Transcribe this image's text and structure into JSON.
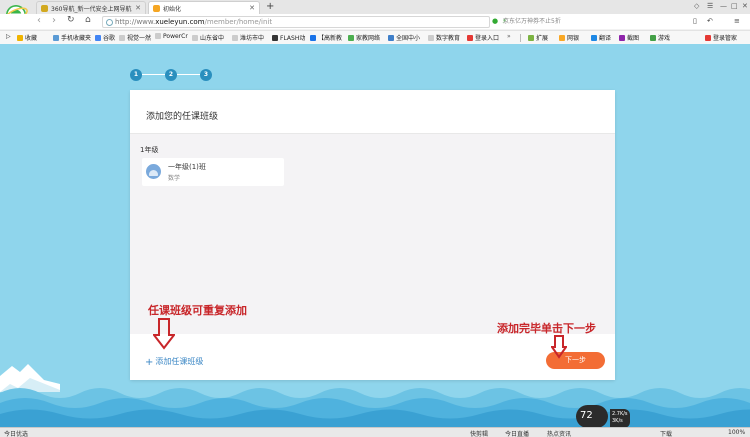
{
  "browser": {
    "tabs": [
      {
        "title": "360导航_新一代安全上网导航"
      },
      {
        "title": "初始化"
      }
    ],
    "new_tab": "+",
    "address": {
      "prefix": "http://www.",
      "domain": "xueleyun.com",
      "path": "/member/home/init"
    },
    "search_placeholder": "京东亿万神券不止5折",
    "bookmarks": [
      "收藏",
      "手机收藏夹",
      "谷歌",
      "视觉一然",
      "PowerCr",
      "山东省中",
      "潍坊市中",
      "FLASH动",
      "【高新教",
      "家教网络",
      "全国中小",
      "数字教育",
      "登录入口"
    ],
    "right_tools": [
      "扩展",
      "网银",
      "翻译",
      "截图",
      "游戏",
      "登录管家"
    ]
  },
  "wizard": {
    "steps": [
      "1",
      "2",
      "3"
    ],
    "title": "添加您的任课班级",
    "grade_label": "1年级",
    "class": {
      "name": "一年级(1)班",
      "subject": "数学"
    },
    "add_link": "添加任课班级",
    "next_button": "下一步"
  },
  "annotations": {
    "left": "任课班级可重复添加",
    "right": "添加完毕单击下一步"
  },
  "status_bar": {
    "left": "今日优选",
    "items": [
      "快剪辑",
      "今日直播",
      "热点资讯"
    ],
    "download": "下载",
    "zoom": "100%"
  },
  "speed_widget": {
    "percent": "72",
    "unit": "%",
    "up": "2.7K/s",
    "down": "3K/s"
  },
  "colors": {
    "sky": "#8fd5ec",
    "accent": "#f36d35",
    "step": "#2a8fbe",
    "link": "#3b87c5",
    "annotation": "#c8262a"
  }
}
